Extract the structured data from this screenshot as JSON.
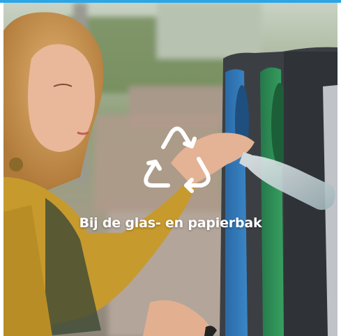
{
  "caption": "Bij de glas- en papierbak",
  "icon": "recycle-icon",
  "colors": {
    "accent_bar": "#2aa6e6",
    "blue_bin": "#2f78b8",
    "green_bin": "#2e8a4e",
    "bin_body": "#3b3f44",
    "sweater": "#c79a2e"
  }
}
